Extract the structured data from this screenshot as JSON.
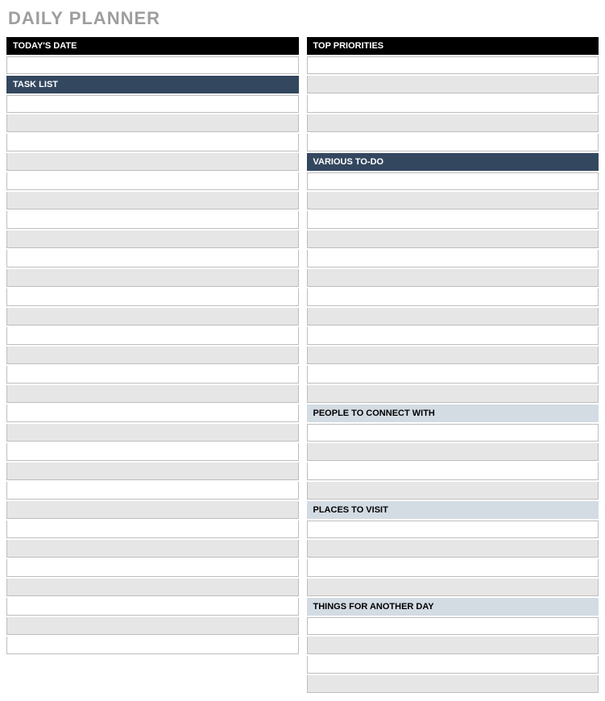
{
  "title": "DAILY PLANNER",
  "left": {
    "today_header": "TODAY'S DATE",
    "today_value": "",
    "task_header": "TASK LIST",
    "task_rows": [
      "",
      "",
      "",
      "",
      "",
      "",
      "",
      "",
      "",
      "",
      "",
      "",
      "",
      "",
      "",
      "",
      "",
      "",
      "",
      "",
      "",
      "",
      "",
      "",
      "",
      "",
      "",
      "",
      ""
    ]
  },
  "right": {
    "priorities_header": "TOP PRIORITIES",
    "priorities_rows": [
      "",
      "",
      "",
      "",
      ""
    ],
    "todo_header": "VARIOUS TO-DO",
    "todo_rows": [
      "",
      "",
      "",
      "",
      "",
      "",
      "",
      "",
      "",
      "",
      "",
      ""
    ],
    "people_header": "PEOPLE TO CONNECT WITH",
    "people_rows": [
      "",
      "",
      "",
      ""
    ],
    "places_header": "PLACES TO VISIT",
    "places_rows": [
      "",
      "",
      "",
      ""
    ],
    "things_header": "THINGS FOR ANOTHER DAY",
    "things_rows": [
      "",
      "",
      "",
      ""
    ]
  }
}
